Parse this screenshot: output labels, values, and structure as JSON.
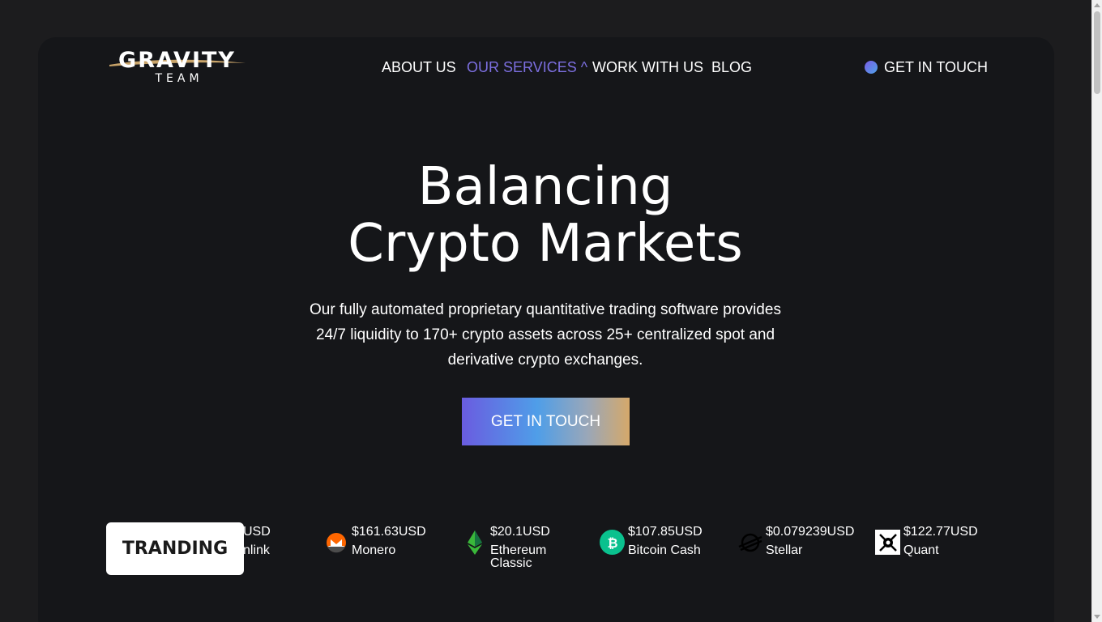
{
  "brand": {
    "logo_word": "GRAVITY",
    "logo_sub": "TEAM"
  },
  "nav": {
    "items": [
      {
        "label": "ABOUT US"
      },
      {
        "label": "OUR SERVICES ^"
      },
      {
        "label": "WORK WITH US"
      },
      {
        "label": "BLOG"
      }
    ],
    "active_color": "#7c6fe0",
    "cta_label": "GET IN TOUCH"
  },
  "hero": {
    "title_line1": "Balancing",
    "title_line2": "Crypto Markets",
    "subtitle": "Our fully automated proprietary quantitative trading software provides 24/7 liquidity to 170+ crypto assets across 25+ centralized spot and derivative crypto exchanges.",
    "button_label": "GET IN TOUCH"
  },
  "ticker": {
    "badge": "TRANDING",
    "items": [
      {
        "price": "USD",
        "name": "nlink",
        "icon": "chainlink-icon"
      },
      {
        "price": "$161.63USD",
        "name": "Monero",
        "icon": "monero-icon"
      },
      {
        "price": "$20.1USD",
        "name": "Ethereum Classic",
        "icon": "ethereum-classic-icon"
      },
      {
        "price": "$107.85USD",
        "name": "Bitcoin Cash",
        "icon": "bitcoin-cash-icon"
      },
      {
        "price": "$0.079239USD",
        "name": "Stellar",
        "icon": "stellar-icon"
      },
      {
        "price": "$122.77USD",
        "name": "Quant",
        "icon": "quant-icon"
      }
    ]
  },
  "colors": {
    "background": "#1c1c1e",
    "panel": "#151619",
    "accent": "#7c6fe0"
  }
}
